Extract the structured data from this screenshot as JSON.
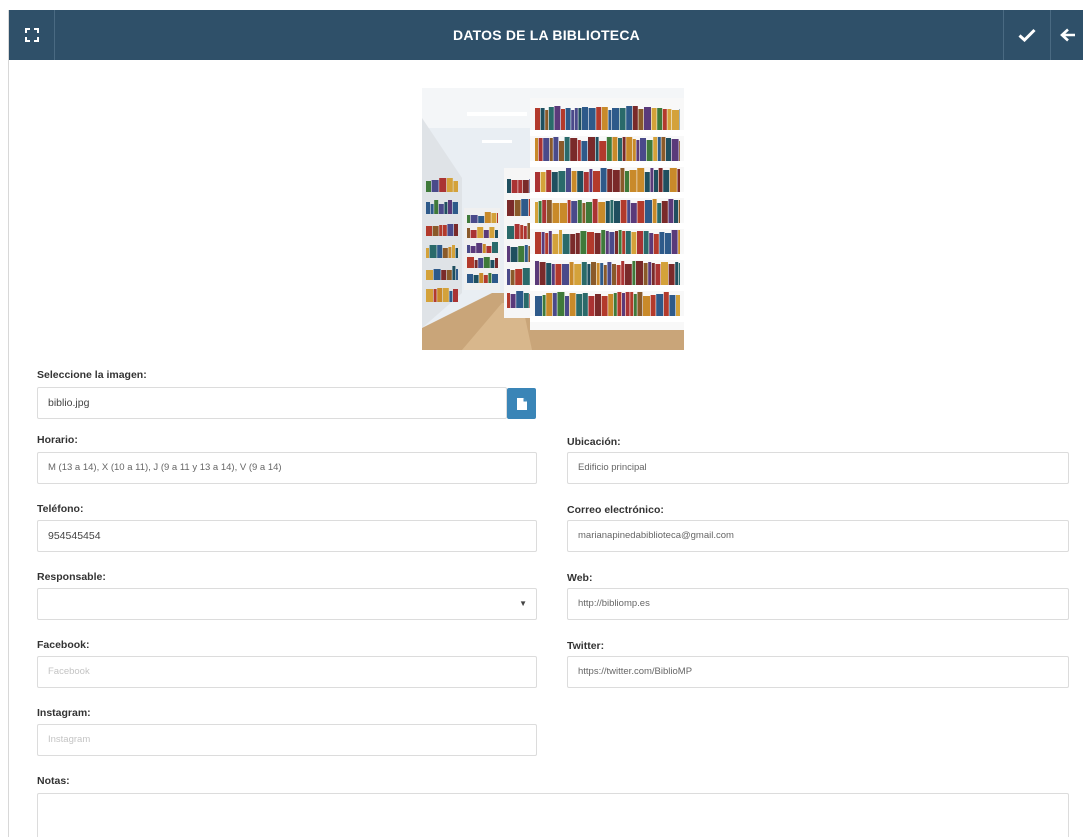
{
  "header": {
    "title": "DATOS DE LA BIBLIOTECA",
    "expand_icon": "expand-icon",
    "save_icon": "checkmark-icon",
    "back_icon": "arrow-left-icon",
    "background_color": "#2f5069"
  },
  "image_field": {
    "label": "Seleccione la imagen:",
    "value": "biblio.jpg",
    "button_icon": "file-icon",
    "button_color": "#3a85b7"
  },
  "fields": {
    "horario": {
      "label": "Horario:",
      "value": "M (13 a 14), X (10 a 11), J (9 a 11 y 13 a 14), V (9 a 14)"
    },
    "ubicacion": {
      "label": "Ubicación:",
      "value": "Edificio principal"
    },
    "telefono": {
      "label": "Teléfono:",
      "value": "954545454"
    },
    "correo": {
      "label": "Correo electrónico:",
      "value": "marianapinedabiblioteca@gmail.com"
    },
    "responsable": {
      "label": "Responsable:",
      "value": ""
    },
    "web": {
      "label": "Web:",
      "value": "http://bibliomp.es"
    },
    "facebook": {
      "label": "Facebook:",
      "placeholder": "Facebook"
    },
    "twitter": {
      "label": "Twitter:",
      "value": "https://twitter.com/BiblioMP"
    },
    "instagram": {
      "label": "Instagram:",
      "placeholder": "Instagram"
    },
    "notas": {
      "label": "Notas:"
    }
  }
}
